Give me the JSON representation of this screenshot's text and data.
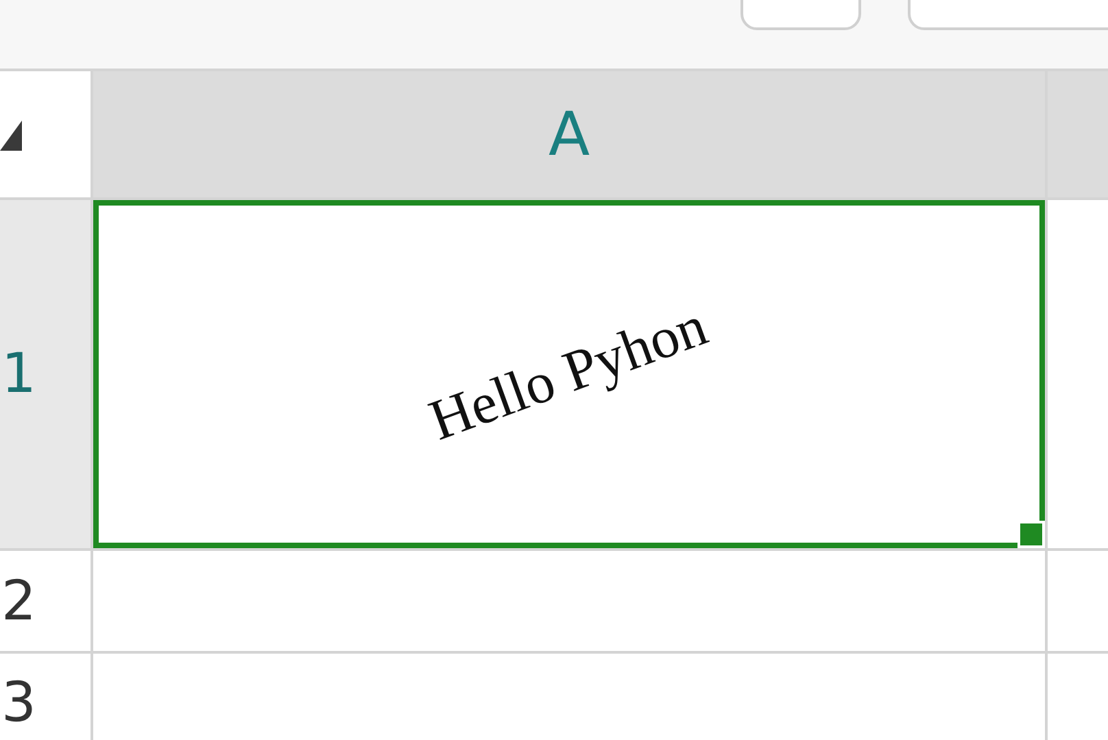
{
  "columns": [
    {
      "label": "A"
    }
  ],
  "rows": [
    {
      "header": "1",
      "cell": {
        "value": "Hello Pyhon",
        "selected": true
      }
    },
    {
      "header": "2",
      "cell": {
        "selected": false
      }
    },
    {
      "header": "3",
      "cell": {
        "selected": false
      }
    }
  ]
}
